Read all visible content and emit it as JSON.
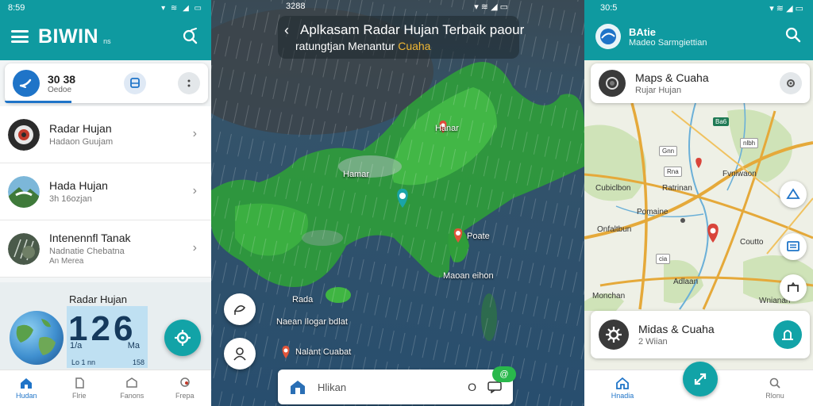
{
  "left": {
    "status": {
      "time": "8:59",
      "icons": "▾ ≋ ◢ ▭"
    },
    "brand": "BIWIN",
    "brand_suffix": "ns",
    "summary": {
      "value": "30 38",
      "sub": "Oedoe"
    },
    "list": [
      {
        "title": "Radar Hujan",
        "sub": "Hadaon Guujam",
        "sub2": ""
      },
      {
        "title": "Hada Hujan",
        "sub": "3h 16ozjan",
        "sub2": ""
      },
      {
        "title": "Intenennfl Tanak",
        "sub": "Nadnatie Chebatna",
        "sub2": "An Merea"
      }
    ],
    "radar_card": {
      "title": "Radar Hujan",
      "number": "126",
      "unit_left": "1/a",
      "unit_right": "Ma",
      "foot_left": "Lo 1 nn",
      "foot_right": "158"
    },
    "nav": [
      {
        "label": "Hudan",
        "icon": "home-icon"
      },
      {
        "label": "Flrie",
        "icon": "file-icon"
      },
      {
        "label": "Fanons",
        "icon": "shield-icon"
      },
      {
        "label": "Frepa",
        "icon": "chat-icon"
      }
    ]
  },
  "middle": {
    "status": {
      "time": "3288",
      "icons": "▾ ≋ ◢ ▭"
    },
    "title_line1": "Aplkasam Radar Hujan Terbaik paour",
    "title_line2": "ratungtjan Menantur",
    "title_highlight": "Cuaha",
    "pins": [
      {
        "label": "Hanar"
      },
      {
        "label": "Hamar"
      },
      {
        "label": "Poate"
      },
      {
        "label": "Maoan eihon"
      },
      {
        "label": "Rada"
      },
      {
        "label": "Naean Ilogar bdlat"
      },
      {
        "label": "Nalant Cuabat"
      }
    ],
    "search_placeholder": "Hlikan",
    "search_right": "O",
    "badge": "@"
  },
  "right": {
    "status": {
      "time": "30:5",
      "icons": "▾ ≋ ◢ ▭"
    },
    "app_title": "BAtie",
    "app_sub": "Madeo Sarmgiettian",
    "card_top": {
      "title": "Maps & Cuaha",
      "sub": "Rujar Hujan"
    },
    "card_bottom": {
      "title": "Midas & Cuaha",
      "sub": "2 Wiian"
    },
    "map_labels": [
      "Cubiclbon",
      "Fvniwaon",
      "Ratrinan",
      "Pomaine",
      "Onfaltbun",
      "Coutto",
      "Adlaan",
      "Monchan",
      "Wnianan"
    ],
    "map_badges": [
      "Ba6",
      "nlbh",
      "Gnn",
      "Rna",
      "cia"
    ],
    "nav": [
      {
        "label": "Hnadia",
        "icon": "home-icon"
      },
      {
        "label": "Rlonu",
        "icon": "search-icon"
      }
    ]
  }
}
